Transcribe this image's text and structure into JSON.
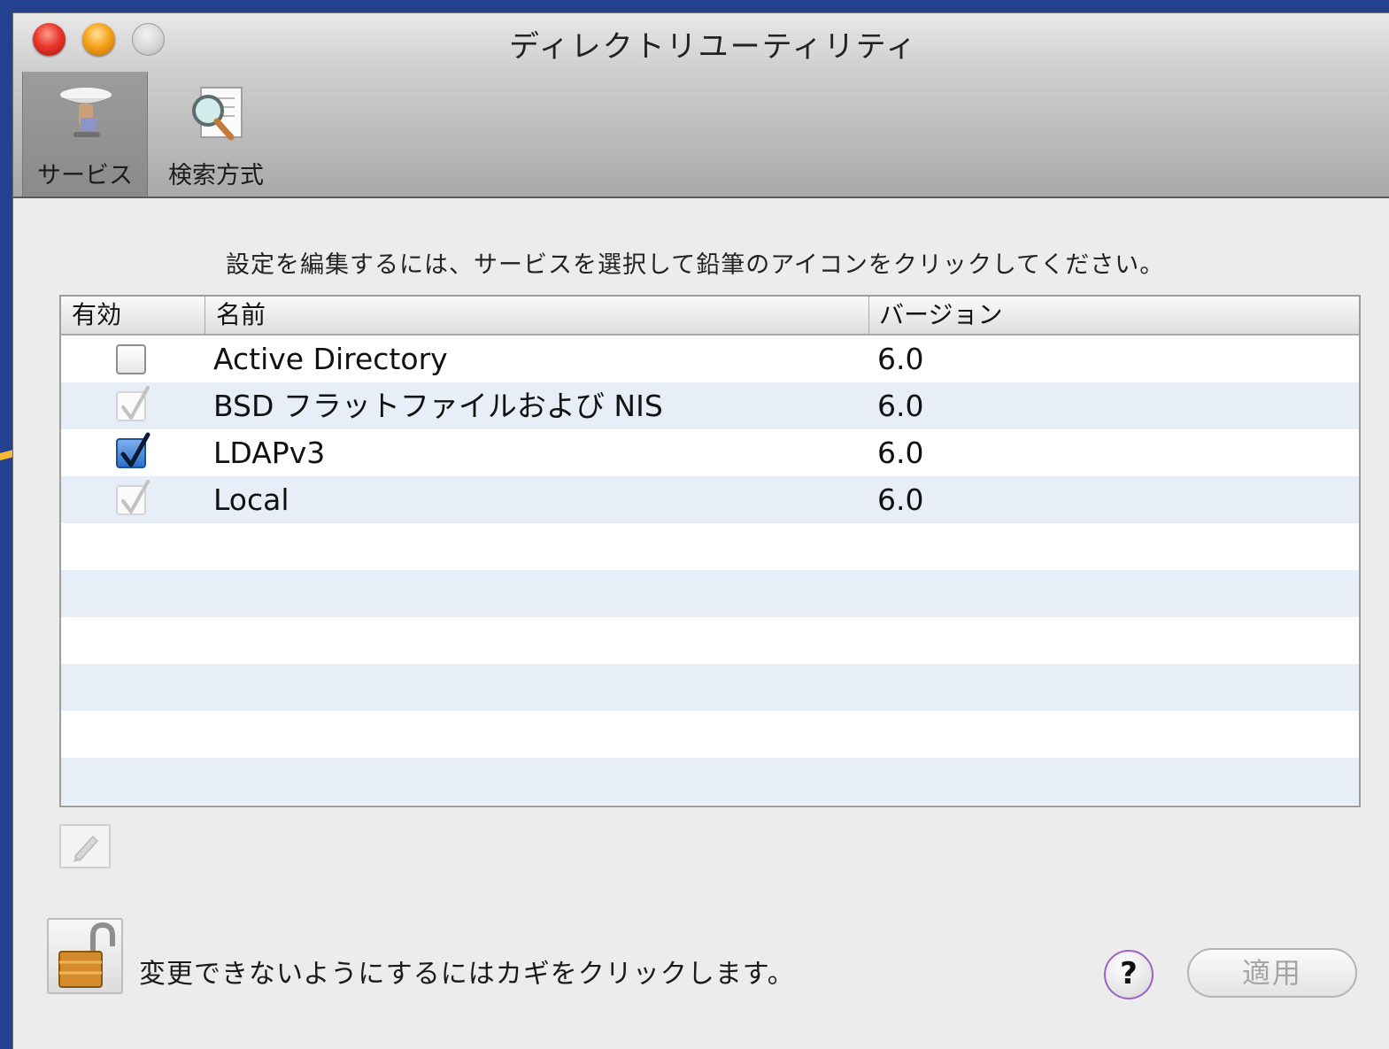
{
  "window": {
    "title": "ディレクトリユーティリティ"
  },
  "toolbar": {
    "items": [
      {
        "label": "サービス",
        "icon": "services-icon",
        "selected": true
      },
      {
        "label": "検索方式",
        "icon": "search-policy-icon",
        "selected": false
      }
    ]
  },
  "instruction": "設定を編集するには、サービスを選択して鉛筆のアイコンをクリックしてください。",
  "table": {
    "columns": [
      "有効",
      "名前",
      "バージョン"
    ],
    "rows": [
      {
        "enabled": "unchecked",
        "name": "Active Directory",
        "version": "6.0"
      },
      {
        "enabled": "checked-disabled",
        "name": "BSD フラットファイルおよび NIS",
        "version": "6.0"
      },
      {
        "enabled": "checked",
        "name": "LDAPv3",
        "version": "6.0"
      },
      {
        "enabled": "checked-disabled",
        "name": "Local",
        "version": "6.0"
      }
    ]
  },
  "footer": {
    "lock_text": "変更できないようにするにはカギをクリックします。",
    "help_label": "?",
    "apply_label": "適用"
  },
  "colors": {
    "desktop": "#24418f",
    "annotation_arrow": "#f5b82e",
    "checkbox_on": "#2f6fca",
    "row_alt": "#e8eef8"
  }
}
